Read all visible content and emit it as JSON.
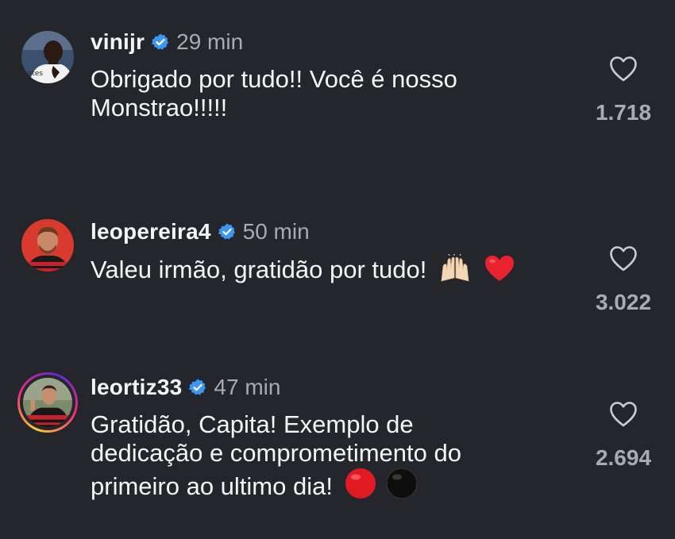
{
  "comments": [
    {
      "username": "vinijr",
      "verified": true,
      "time": "29 min",
      "text_line1": "Obrigado por tudo!! Você é nosso",
      "text_line2": "Monstrao!!!!!",
      "likes": "1.718",
      "avatar_story_ring": false,
      "avatar_shirt_text": "rates"
    },
    {
      "username": "leopereira4",
      "verified": true,
      "time": "50 min",
      "text": "Valeu irmão, gratidão por tudo!",
      "emojis": [
        "raising-hands-emoji",
        "red-heart-emoji"
      ],
      "likes": "3.022",
      "avatar_story_ring": false
    },
    {
      "username": "leortiz33",
      "verified": true,
      "time": "47 min",
      "text_line1": "Gratidão, Capita! Exemplo de",
      "text_line2": "dedicação e comprometimento do",
      "text_line3": "primeiro ao ultimo dia!",
      "emojis": [
        "red-circle-emoji",
        "black-circle-emoji"
      ],
      "likes": "2.694",
      "avatar_story_ring": true
    }
  ],
  "colors": {
    "background": "#24262b",
    "text": "#f4f5f7",
    "muted": "#a7abb3",
    "verified": "#3b97f0"
  }
}
